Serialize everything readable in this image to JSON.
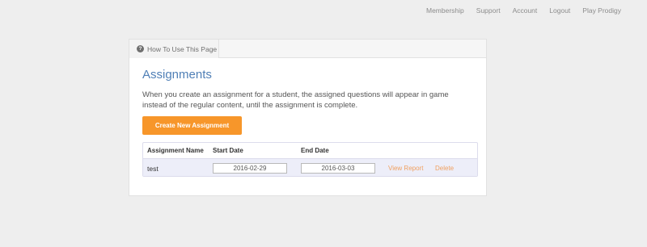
{
  "topnav": {
    "items": [
      {
        "label": "Membership"
      },
      {
        "label": "Support"
      },
      {
        "label": "Account"
      },
      {
        "label": "Logout"
      },
      {
        "label": "Play Prodigy"
      }
    ]
  },
  "tabbar": {
    "help_tab_label": "How To Use This Page"
  },
  "main": {
    "title": "Assignments",
    "description": "When you create an assignment for a student, the assigned questions will appear in game instead of the regular content, until the assignment is complete.",
    "create_button_label": "Create New Assignment"
  },
  "table": {
    "headers": {
      "name": "Assignment Name",
      "start": "Start Date",
      "end": "End Date"
    },
    "rows": [
      {
        "name": "test",
        "start_date": "2016-02-29",
        "end_date": "2016-03-03",
        "view_report_label": "View Report",
        "delete_label": "Delete"
      }
    ]
  },
  "colors": {
    "accent": "#f7962a",
    "title": "#4f7fb6",
    "link": "#f0a060"
  }
}
